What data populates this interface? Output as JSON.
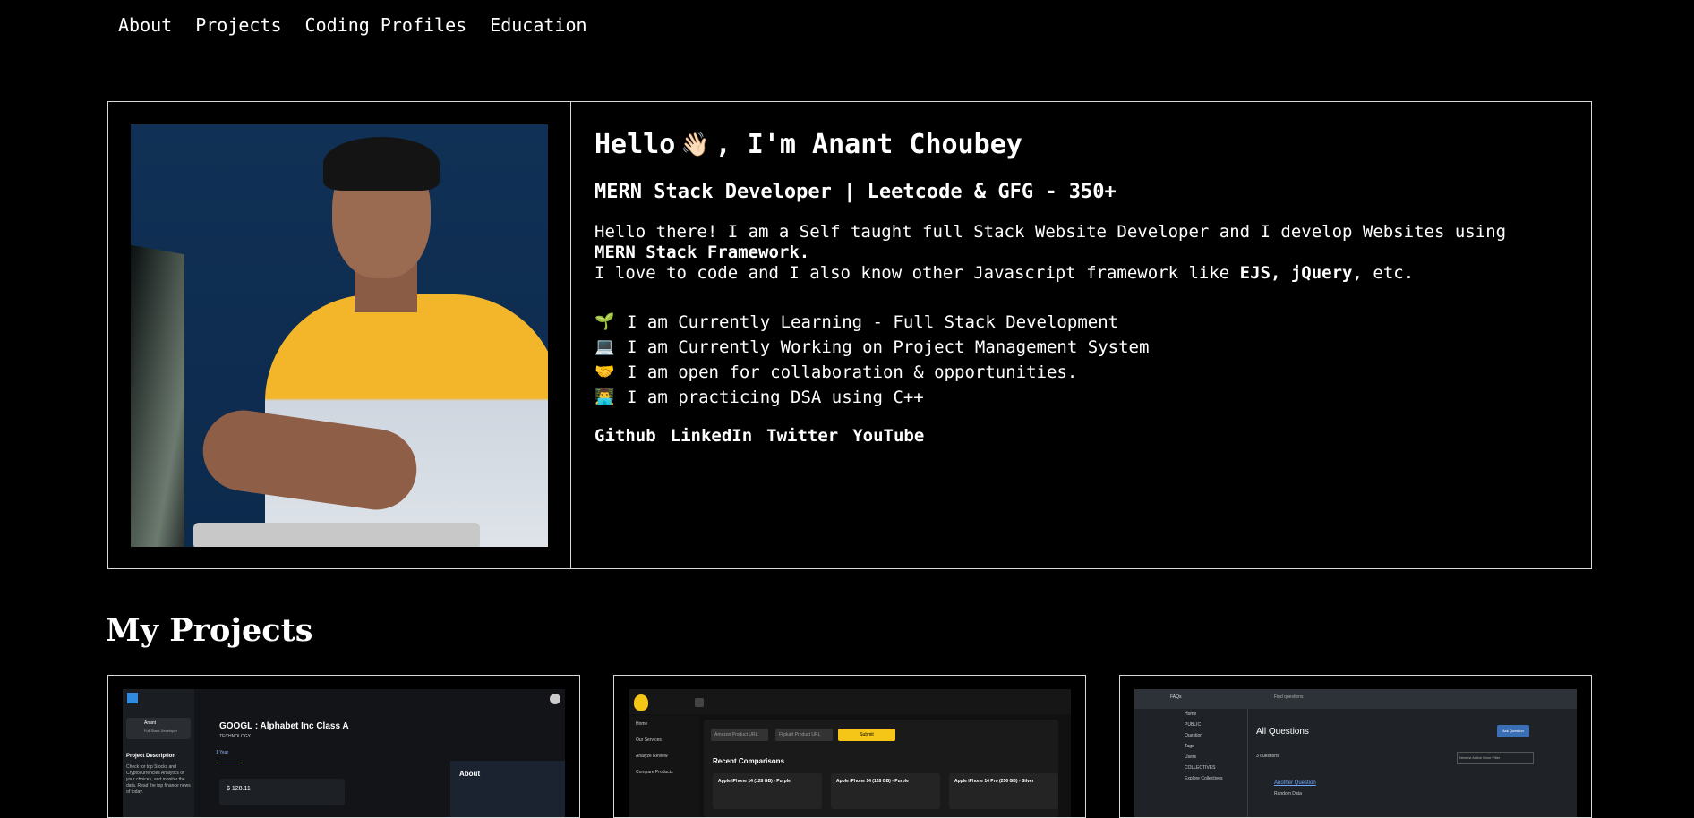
{
  "nav": {
    "items": [
      "About",
      "Projects",
      "Coding Profiles",
      "Education"
    ]
  },
  "hero": {
    "greeting_pre": "Hello",
    "greeting_wave": "👋🏻",
    "greeting_post": ", I'm Anant Choubey",
    "subtitle": "MERN Stack Developer | Leetcode & GFG - 350+",
    "desc_line1": "Hello there! I am a Self taught full Stack Website Developer and I develop Websites using",
    "desc_bold1": "MERN Stack Framework.",
    "desc_line3a": "I love to code and I also know other Javascript framework like ",
    "desc_bold2": "EJS, jQuery",
    "desc_line3b": ", etc.",
    "facts": [
      {
        "icon": "🌱",
        "text": "I am Currently Learning - Full Stack Development"
      },
      {
        "icon": "💻",
        "text": "I am Currently Working on Project Management System"
      },
      {
        "icon": "🤝",
        "text": "I am open for collaboration & opportunities."
      },
      {
        "icon": "👨‍💻",
        "text": "I am practicing DSA using C++"
      }
    ],
    "socials": [
      "Github",
      "LinkedIn",
      "Twitter",
      "YouTube"
    ]
  },
  "projects": {
    "title": "My Projects",
    "card1": {
      "user": "Anant",
      "user_role": "Full Stack Developer",
      "title": "GOOGL : Alphabet Inc Class A",
      "tag": "TECHNOLOGY",
      "tab": "1 Year",
      "price": "$ 128.11",
      "about": "About",
      "pdesc_title": "Project Description",
      "pdesc_text": "Check for top Stocks and Cryptocurrencies Analytics of your choices, and monitor the data. Read the top finance news of today."
    },
    "card2": {
      "side_items": [
        "Home",
        "Our Services",
        "Analyze Review",
        "Compare Products"
      ],
      "input1": "Amazon Product URL",
      "input2": "Flipkart Product URL",
      "submit": "Submit",
      "recent": "Recent Comparisons",
      "items": [
        "Apple iPhone 14 (128 GB) - Purple",
        "Apple iPhone 14 (128 GB) - Purple",
        "Apple iPhone 14 Pro (256 GB) - Silver"
      ]
    },
    "card3": {
      "faq": "FAQs",
      "search": "Find questions",
      "side_items": [
        "Home",
        "PUBLIC",
        "Question",
        "Tags",
        "Users",
        "COLLECTIVES",
        "Explore Collectives"
      ],
      "all_q": "All Questions",
      "ask": "Ask Question",
      "count": "3 questions",
      "filters": "Newest  Active  More  Filter",
      "q_link": "Another Question",
      "q_text": "Random Data"
    }
  }
}
